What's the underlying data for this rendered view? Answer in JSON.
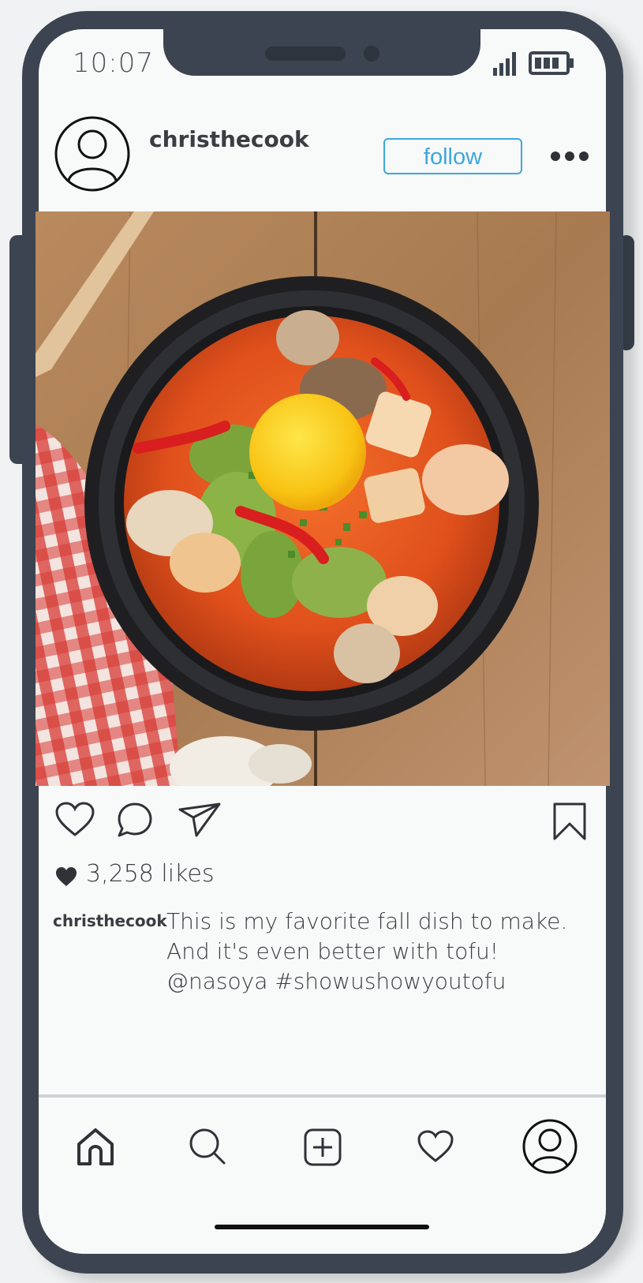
{
  "status_bar": {
    "time": "10:07",
    "icons": [
      "signal-icon",
      "battery-icon"
    ]
  },
  "post": {
    "username": "christhecook",
    "follow_label": "follow",
    "more_icon": "more-icon",
    "image_subject": "bowl of spicy tofu and clam stew with raw egg yolk",
    "likes": "3,258 likes",
    "caption_user": "christhecook",
    "caption_lines": [
      "This is my favorite fall dish to make.",
      "And it's even better with tofu!",
      "@nasoya #showushowyoutofu"
    ],
    "actions": [
      "heart-icon",
      "comment-icon",
      "share-icon",
      "bookmark-icon"
    ]
  },
  "bottom_nav": {
    "items": [
      "home-icon",
      "search-icon",
      "add-post-icon",
      "activity-icon",
      "profile-icon"
    ]
  },
  "colors": {
    "frame": "#3b4450",
    "screen": "#f8f9f9",
    "accent": "#3ea7dc",
    "text": "#3a3d42"
  }
}
